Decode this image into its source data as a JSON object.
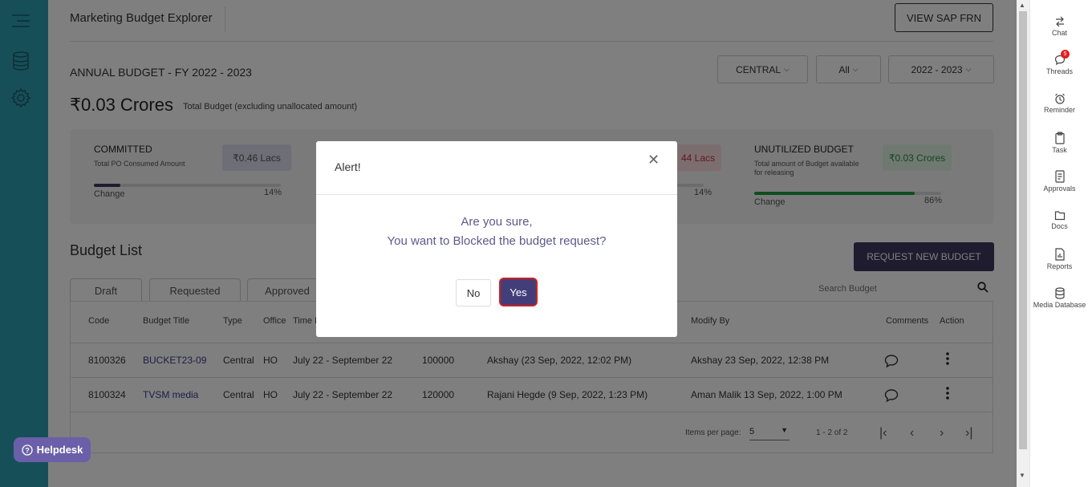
{
  "header": {
    "app_title": "Marketing Budget Explorer",
    "sap_button": "VIEW SAP FRN"
  },
  "budget": {
    "title": "ANNUAL BUDGET - FY 2022 - 2023",
    "amount": "₹0.03 Crores",
    "amount_sub": "Total Budget (excluding unallocated amount)",
    "filters": {
      "region": "CENTRAL",
      "scope": "All",
      "year": "2022 - 2023"
    }
  },
  "stats": {
    "committed": {
      "title": "COMMITTED",
      "subtitle": "Total PO Consumed Amount",
      "value": "₹0.46 Lacs",
      "change_label": "Change",
      "percent": "14%",
      "fraction": 0.14
    },
    "middle": {
      "value_partial": "44 Lacs",
      "percent": "14%"
    },
    "unutilized": {
      "title": "UNUTILIZED BUDGET",
      "subtitle": "Total amount of Budget available for releasing",
      "value": "₹0.03 Crores",
      "change_label": "Change",
      "percent": "86%",
      "fraction": 0.86
    }
  },
  "budget_list": {
    "title": "Budget List",
    "request_button": "REQUEST NEW BUDGET",
    "tabs": [
      "Draft",
      "Requested",
      "Approved"
    ],
    "search_placeholder": "Search Budget",
    "columns": {
      "code": "Code",
      "title": "Budget Title",
      "type": "Type",
      "office": "Office",
      "time": "Time P",
      "modify_by": "Modify By",
      "comments": "Comments",
      "action": "Action"
    },
    "rows": [
      {
        "code": "8100326",
        "title": "BUCKET23-09",
        "type": "Central",
        "office": "HO",
        "time": "July 22 - September 22",
        "amount": "100000",
        "created": "Akshay (23 Sep, 2022, 12:02 PM)",
        "modified": "Akshay 23 Sep, 2022, 12:38 PM"
      },
      {
        "code": "8100324",
        "title": "TVSM media",
        "type": "Central",
        "office": "HO",
        "time": "July 22 - September 22",
        "amount": "120000",
        "created": "Rajani Hegde (9 Sep, 2022, 1:23 PM)",
        "modified": "Aman Malik 13 Sep, 2022, 1:00 PM"
      }
    ],
    "pagination": {
      "items_label": "Items per page:",
      "items_value": "5",
      "range": "1 - 2 of 2"
    }
  },
  "modal": {
    "title": "Alert!",
    "line1": "Are you sure,",
    "line2": "You want to Blocked the budget request?",
    "no": "No",
    "yes": "Yes"
  },
  "right_sidebar": {
    "items": [
      "Chat",
      "Threads",
      "Reminder",
      "Task",
      "Approvals",
      "Docs",
      "Reports",
      "Media Database"
    ],
    "threads_badge": "5"
  },
  "helpdesk": "Helpdesk"
}
